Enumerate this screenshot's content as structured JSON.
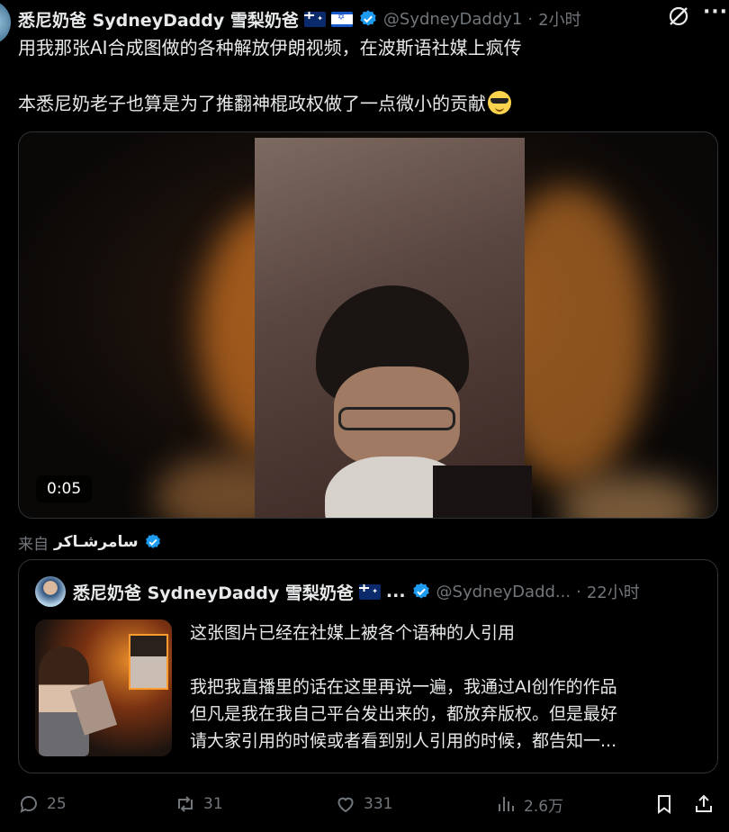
{
  "post": {
    "author_name": "悉尼奶爸 SydneyDaddy 雪梨奶爸",
    "flags": [
      "australia-flag",
      "israel-flag"
    ],
    "handle": "@SydneyDaddy1",
    "separator": "·",
    "time": "2小时",
    "text_line1": "用我那张AI合成图做的各种解放伊朗视频，在波斯语社媒上疯传",
    "text_line2": "本悉尼奶老子也算是为了推翻神棍政权做了一点微小的贡献",
    "text_emoji": "smiling-face-with-sunglasses",
    "video_time": "0:05"
  },
  "source": {
    "prefix": "来自",
    "name": "سامرشـاكر"
  },
  "quote": {
    "author_name": "悉尼奶爸 SydneyDaddy 雪梨奶爸",
    "flag": "australia-flag",
    "ellipsis": "...",
    "handle": "@SydneyDadd...",
    "separator": "·",
    "time": "22小时",
    "line1": "这张图片已经在社媒上被各个语种的人引用",
    "line2": "我把我直播里的话在这里再说一遍，我通过AI创作的作品",
    "line3": "但凡是我在我自己平台发出来的，都放弃版权。但是最好",
    "line4": "请大家引用的时候或者看到别人引用的时候，都告知一..."
  },
  "actions": {
    "replies": "25",
    "reposts": "31",
    "likes": "331",
    "views": "2.6万"
  },
  "colors": {
    "background": "#000000",
    "text": "#e7e9ea",
    "muted": "#71767b",
    "border": "#2f3336",
    "verified": "#1d9bf0"
  }
}
